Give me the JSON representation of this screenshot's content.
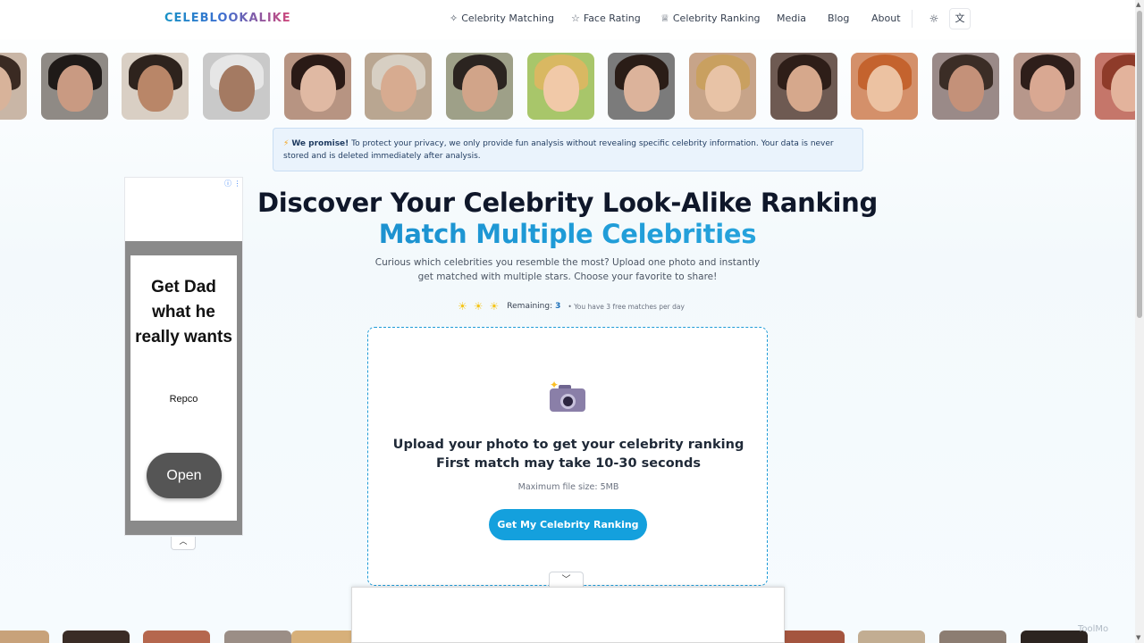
{
  "header": {
    "logo": "CELEBLOOKALIKE",
    "nav": [
      {
        "label": "Celebrity Matching",
        "icon": "sparkles-icon",
        "glyph": "✧"
      },
      {
        "label": "Face Rating",
        "icon": "star-icon",
        "glyph": "☆"
      },
      {
        "label": "Celebrity Ranking",
        "icon": "trophy-icon",
        "glyph": "♕"
      },
      {
        "label": "Media"
      },
      {
        "label": "Blog"
      },
      {
        "label": "About"
      }
    ],
    "theme_glyph": "☼",
    "lang_glyph": "文"
  },
  "notice": {
    "bold": "We promise!",
    "text": " To protect your privacy, we only provide fun analysis without revealing specific celebrity information. Your data is never stored and is deleted immediately after analysis."
  },
  "ad": {
    "title": "Get Dad what he really wants",
    "brand": "Repco",
    "button": "Open",
    "info_glyph": "ⓘ ⋮"
  },
  "hero": {
    "title": "Discover Your Celebrity Look-Alike Ranking",
    "subtitle": "Match Multiple Celebrities",
    "description": "Curious which celebrities you resemble the most? Upload one photo and instantly get matched with multiple stars. Choose your favorite to share!"
  },
  "remaining": {
    "label": "Remaining:",
    "count": "3",
    "note": "• You have 3 free matches per day"
  },
  "upload": {
    "title_line1": "Upload your photo to get your celebrity ranking",
    "title_line2": "First match may take 10-30 seconds",
    "note": "Maximum file size: 5MB",
    "button": "Get My Celebrity Ranking"
  },
  "watermark": "ToolMo"
}
